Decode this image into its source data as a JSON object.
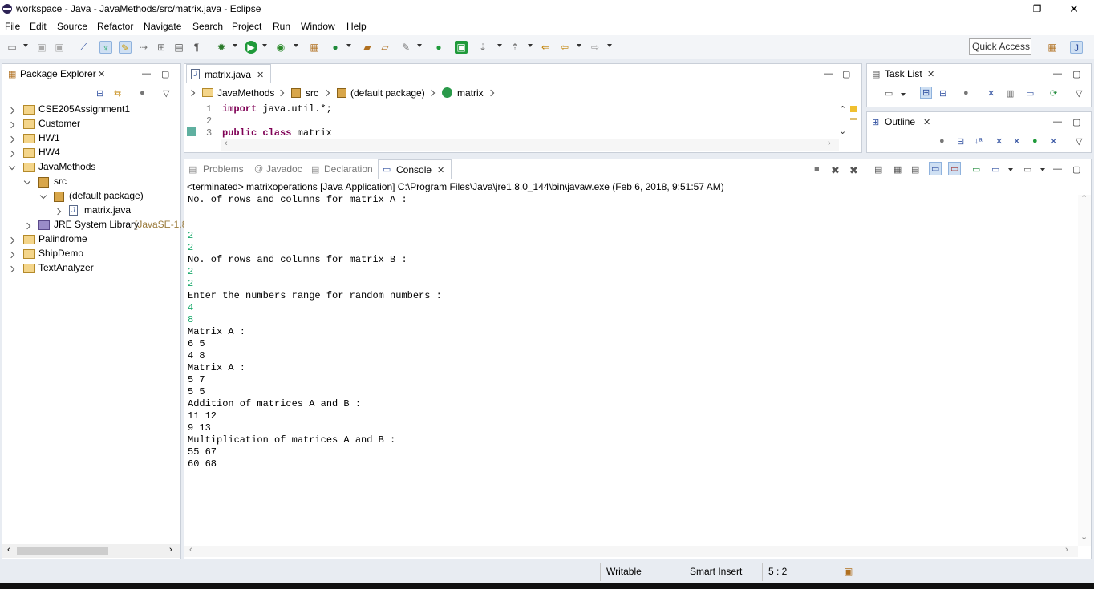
{
  "window": {
    "title": "workspace - Java - JavaMethods/src/matrix.java - Eclipse",
    "minimize": "—",
    "maximize": "❐",
    "close": "✕"
  },
  "menu": [
    "File",
    "Edit",
    "Source",
    "Refactor",
    "Navigate",
    "Search",
    "Project",
    "Run",
    "Window",
    "Help"
  ],
  "toolbar": {
    "quick_access": "Quick Access"
  },
  "package_explorer": {
    "title": "Package Explorer",
    "items": [
      {
        "label": "CSE205Assignment1"
      },
      {
        "label": "Customer"
      },
      {
        "label": "HW1"
      },
      {
        "label": "HW4"
      },
      {
        "label": "JavaMethods"
      },
      {
        "label": "src"
      },
      {
        "label": "(default package)"
      },
      {
        "label": "matrix.java"
      },
      {
        "label": "JRE System Library",
        "suffix": "[JavaSE-1.8"
      },
      {
        "label": "Palindrome"
      },
      {
        "label": "ShipDemo"
      },
      {
        "label": "TextAnalyzer"
      }
    ]
  },
  "editor": {
    "tab": "matrix.java",
    "breadcrumb": [
      "JavaMethods",
      "src",
      "(default package)",
      "matrix"
    ],
    "line_numbers": [
      "1",
      "2",
      "3"
    ],
    "lines": [
      {
        "kw": "import",
        "rest": " java.util.*;"
      },
      {
        "kw": "",
        "rest": ""
      },
      {
        "kw": "public class",
        "rest": " matrix"
      }
    ]
  },
  "task_list": {
    "title": "Task List"
  },
  "outline": {
    "title": "Outline"
  },
  "bottom_tabs": {
    "problems": "Problems",
    "javadoc": "Javadoc",
    "declaration": "Declaration",
    "console": "Console"
  },
  "console": {
    "header": "<terminated> matrixoperations [Java Application] C:\\Program Files\\Java\\jre1.8.0_144\\bin\\javaw.exe (Feb 6, 2018, 9:51:57 AM)",
    "lines": [
      {
        "text": "No. of rows and columns for matrix A :",
        "input": false
      },
      {
        "text": "",
        "input": false
      },
      {
        "text": "",
        "input": false
      },
      {
        "text": "2",
        "input": true
      },
      {
        "text": "2",
        "input": true
      },
      {
        "text": "No. of rows and columns for matrix B :",
        "input": false
      },
      {
        "text": "2",
        "input": true
      },
      {
        "text": "2",
        "input": true
      },
      {
        "text": "Enter the numbers range for random numbers :",
        "input": false
      },
      {
        "text": "4",
        "input": true
      },
      {
        "text": "8",
        "input": true
      },
      {
        "text": "Matrix A :",
        "input": false
      },
      {
        "text": "6 5",
        "input": false
      },
      {
        "text": "4 8",
        "input": false
      },
      {
        "text": "Matrix A :",
        "input": false
      },
      {
        "text": "5 7",
        "input": false
      },
      {
        "text": "5 5",
        "input": false
      },
      {
        "text": "Addition of matrices A and B :",
        "input": false
      },
      {
        "text": "11 12",
        "input": false
      },
      {
        "text": "9 13",
        "input": false
      },
      {
        "text": "Multiplication of matrices A and B :",
        "input": false
      },
      {
        "text": "55 67",
        "input": false
      },
      {
        "text": "60 68",
        "input": false
      }
    ]
  },
  "status": {
    "mode": "Writable",
    "insert": "Smart Insert",
    "position": "5 : 2"
  },
  "colors": {
    "keyword": "#7f0055",
    "input": "#17a86a",
    "selected_tab": "#dbe7f5"
  }
}
